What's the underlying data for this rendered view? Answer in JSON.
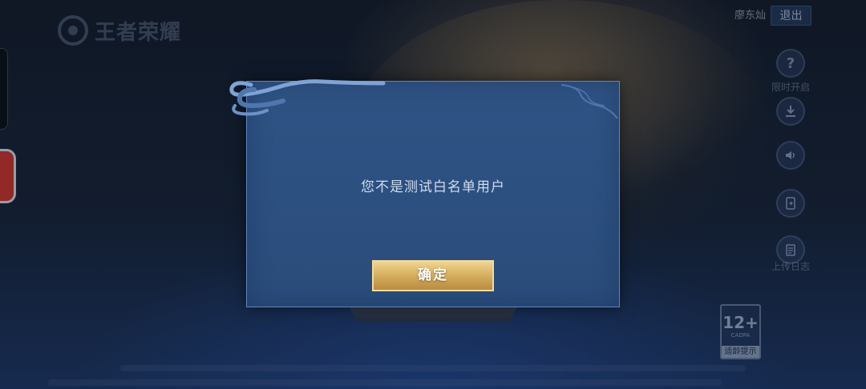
{
  "header": {
    "logo_text": "王者荣耀",
    "user_name": "廖东灿",
    "logout_label": "退出"
  },
  "side_menu": {
    "help_label": "限时开启",
    "help_icon": "question-icon",
    "download_icon": "download-icon",
    "sound_icon": "speaker-icon",
    "switch_icon": "device-switch-icon",
    "log_label": "上传日志",
    "log_icon": "clipboard-icon"
  },
  "age_rating": {
    "value": "12+",
    "org": "CADPA",
    "tip": "适龄提示"
  },
  "dialog": {
    "message": "您不是测试白名单用户",
    "confirm_label": "确定"
  },
  "colors": {
    "dialog_bg": "#2c5080",
    "dialog_border": "#5f86bf",
    "button_gold": "#d9b163",
    "message_text": "#cfdcee"
  }
}
